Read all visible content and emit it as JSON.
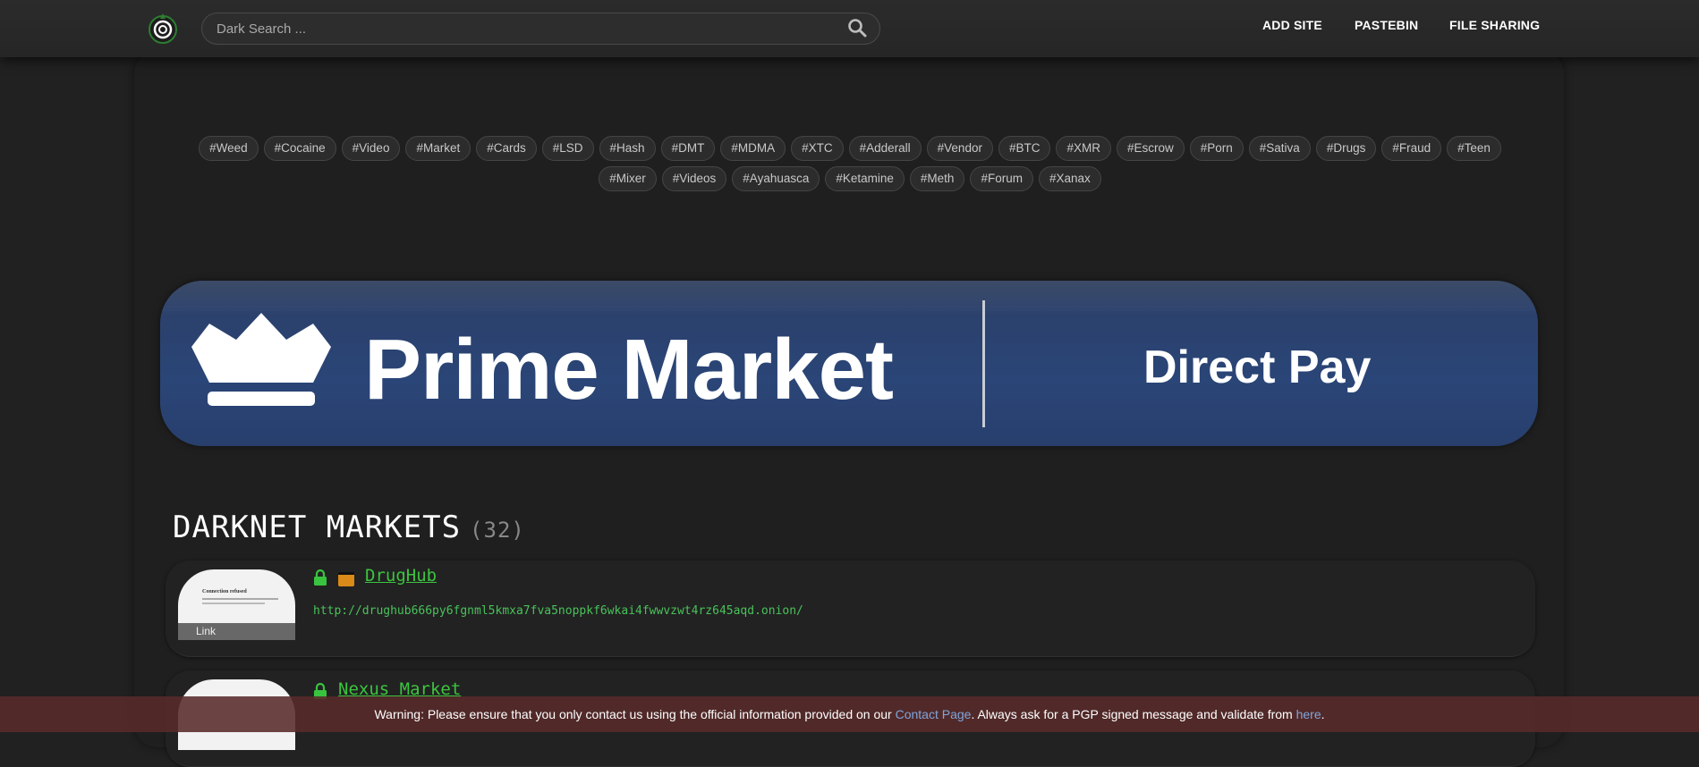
{
  "header": {
    "search_placeholder": "Dark Search ...",
    "nav": [
      "ADD SITE",
      "PASTEBIN",
      "FILE SHARING"
    ]
  },
  "tags": [
    "#Weed",
    "#Cocaine",
    "#Video",
    "#Market",
    "#Cards",
    "#LSD",
    "#Hash",
    "#DMT",
    "#MDMA",
    "#XTC",
    "#Adderall",
    "#Vendor",
    "#BTC",
    "#XMR",
    "#Escrow",
    "#Porn",
    "#Sativa",
    "#Drugs",
    "#Fraud",
    "#Teen",
    "#Mixer",
    "#Videos",
    "#Ayahuasca",
    "#Ketamine",
    "#Meth",
    "#Forum",
    "#Xanax"
  ],
  "banner": {
    "title": "Prime Market",
    "subtitle": "Direct Pay"
  },
  "section": {
    "title": "DARKNET MARKETS",
    "count": "(32)"
  },
  "cards": [
    {
      "name": "DrugHub",
      "url": "http://drughub666py6fgnml5kmxa7fva5noppkf6wkai4fwwvzwt4rz645aqd.onion/",
      "thumb_title": "Connection refused",
      "thumb_caption": "Link"
    },
    {
      "name": "Nexus Market",
      "url": "",
      "thumb_title": "",
      "thumb_caption": ""
    }
  ],
  "warning": {
    "before": "Warning: Please ensure that you only contact us using the official information provided on our ",
    "link1": "Contact Page",
    "middle": ". Always ask for a PGP signed message and validate from ",
    "link2": "here",
    "after": "."
  },
  "colors": {
    "accent_green": "#39c43f",
    "banner_blue": "#2a4577",
    "warning_bg": "#582a2a"
  }
}
